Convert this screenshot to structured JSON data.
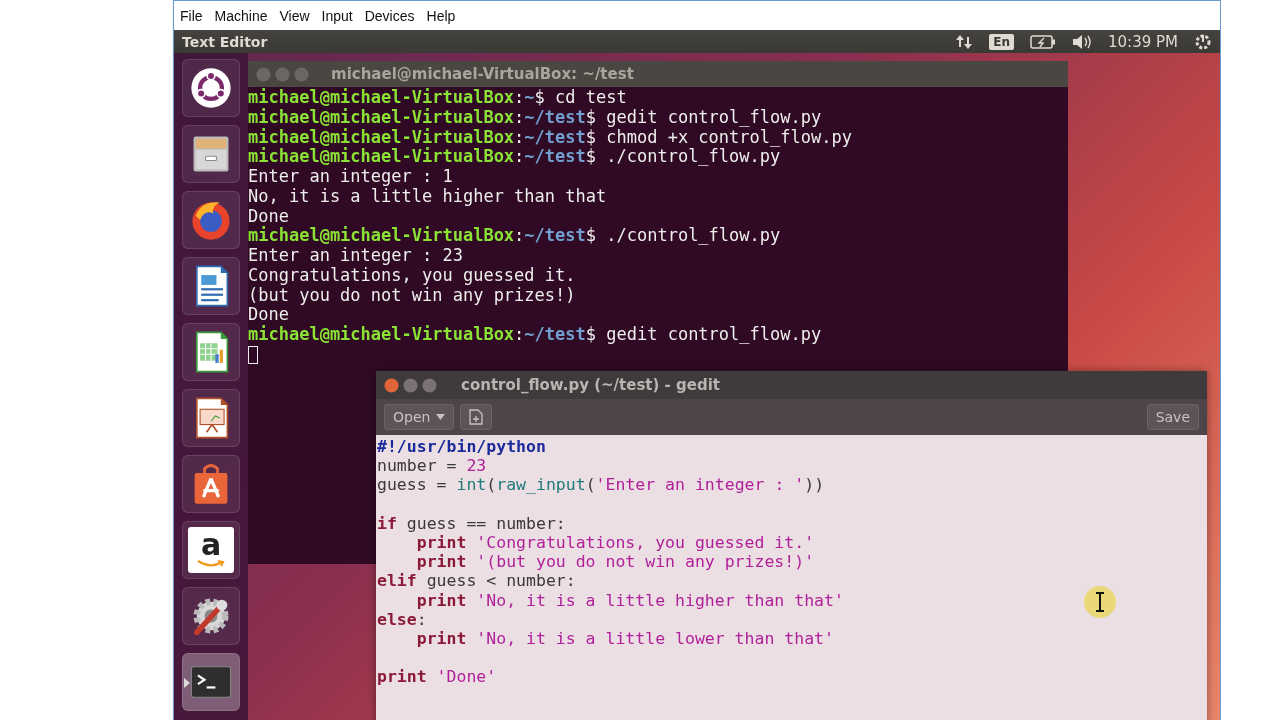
{
  "vbox_menu": [
    "File",
    "Machine",
    "View",
    "Input",
    "Devices",
    "Help"
  ],
  "top_panel": {
    "app_title": "Text Editor",
    "keyboard_layout": "En",
    "clock": "10:39 PM"
  },
  "launcher": [
    {
      "kind": "ubuntu",
      "running": false,
      "active": false
    },
    {
      "kind": "files",
      "running": false,
      "active": false
    },
    {
      "kind": "browser",
      "running": false,
      "active": false
    },
    {
      "kind": "writer",
      "running": false,
      "active": false
    },
    {
      "kind": "calc",
      "running": false,
      "active": false
    },
    {
      "kind": "impress",
      "running": false,
      "active": false
    },
    {
      "kind": "software",
      "running": false,
      "active": false
    },
    {
      "kind": "amazon",
      "glyph": "a",
      "running": false,
      "active": false
    },
    {
      "kind": "settings",
      "running": false,
      "active": false
    },
    {
      "kind": "terminal",
      "running": true,
      "active": true
    }
  ],
  "terminal": {
    "title": "michael@michael-VirtualBox: ~/test",
    "cursor": true,
    "lines": [
      [
        {
          "text": "michael@michael-VirtualBox",
          "kind": "user"
        },
        {
          "text": ":",
          "kind": "plain"
        },
        {
          "text": "~",
          "kind": "path"
        },
        {
          "text": "$ cd test",
          "kind": "plain"
        }
      ],
      [
        {
          "text": "michael@michael-VirtualBox",
          "kind": "user"
        },
        {
          "text": ":",
          "kind": "plain"
        },
        {
          "text": "~/test",
          "kind": "path"
        },
        {
          "text": "$ gedit control_flow.py",
          "kind": "plain"
        }
      ],
      [
        {
          "text": "michael@michael-VirtualBox",
          "kind": "user"
        },
        {
          "text": ":",
          "kind": "plain"
        },
        {
          "text": "~/test",
          "kind": "path"
        },
        {
          "text": "$ chmod +x control_flow.py",
          "kind": "plain"
        }
      ],
      [
        {
          "text": "michael@michael-VirtualBox",
          "kind": "user"
        },
        {
          "text": ":",
          "kind": "plain"
        },
        {
          "text": "~/test",
          "kind": "path"
        },
        {
          "text": "$ ./control_flow.py",
          "kind": "plain"
        }
      ],
      [
        {
          "text": "Enter an integer : 1",
          "kind": "plain"
        }
      ],
      [
        {
          "text": "No, it is a little higher than that",
          "kind": "plain"
        }
      ],
      [
        {
          "text": "Done",
          "kind": "plain"
        }
      ],
      [
        {
          "text": "michael@michael-VirtualBox",
          "kind": "user"
        },
        {
          "text": ":",
          "kind": "plain"
        },
        {
          "text": "~/test",
          "kind": "path"
        },
        {
          "text": "$ ./control_flow.py",
          "kind": "plain"
        }
      ],
      [
        {
          "text": "Enter an integer : 23",
          "kind": "plain"
        }
      ],
      [
        {
          "text": "Congratulations, you guessed it.",
          "kind": "plain"
        }
      ],
      [
        {
          "text": "(but you do not win any prizes!)",
          "kind": "plain"
        }
      ],
      [
        {
          "text": "Done",
          "kind": "plain"
        }
      ],
      [
        {
          "text": "michael@michael-VirtualBox",
          "kind": "user"
        },
        {
          "text": ":",
          "kind": "plain"
        },
        {
          "text": "~/test",
          "kind": "path"
        },
        {
          "text": "$ gedit control_flow.py",
          "kind": "plain"
        }
      ]
    ]
  },
  "gedit": {
    "title": "control_flow.py (~/test) - gedit",
    "open_button": "Open",
    "save_button": "Save",
    "lines": [
      {
        "blank_before": false,
        "indented": false,
        "segments": [
          {
            "text": "#!/usr/bin/python",
            "kind": "shebang"
          }
        ]
      },
      {
        "blank_before": false,
        "indented": false,
        "segments": [
          {
            "text": "number = ",
            "kind": "plain"
          },
          {
            "text": "23",
            "kind": "number"
          }
        ]
      },
      {
        "blank_before": false,
        "indented": false,
        "segments": [
          {
            "text": "guess = ",
            "kind": "plain"
          },
          {
            "text": "int",
            "kind": "builtin"
          },
          {
            "text": "(",
            "kind": "plain"
          },
          {
            "text": "raw_input",
            "kind": "builtin"
          },
          {
            "text": "(",
            "kind": "plain"
          },
          {
            "text": "'Enter an integer : '",
            "kind": "string"
          },
          {
            "text": "))",
            "kind": "plain"
          }
        ]
      },
      {
        "blank_before": true,
        "indented": false,
        "segments": [
          {
            "text": "if",
            "kind": "keyword"
          },
          {
            "text": " guess == number:",
            "kind": "plain"
          }
        ]
      },
      {
        "blank_before": false,
        "indented": true,
        "segments": [
          {
            "text": "print",
            "kind": "keyword"
          },
          {
            "text": " 'Congratulations, you guessed it.'",
            "kind": "string"
          }
        ]
      },
      {
        "blank_before": false,
        "indented": true,
        "segments": [
          {
            "text": "print",
            "kind": "keyword"
          },
          {
            "text": " '(but you do not win any prizes!)'",
            "kind": "string"
          }
        ]
      },
      {
        "blank_before": false,
        "indented": false,
        "segments": [
          {
            "text": "elif",
            "kind": "keyword"
          },
          {
            "text": " guess < number:",
            "kind": "plain"
          }
        ]
      },
      {
        "blank_before": false,
        "indented": true,
        "segments": [
          {
            "text": "print",
            "kind": "keyword"
          },
          {
            "text": " 'No, it is a little higher than that'",
            "kind": "string"
          }
        ]
      },
      {
        "blank_before": false,
        "indented": false,
        "segments": [
          {
            "text": "else",
            "kind": "keyword"
          },
          {
            "text": ":",
            "kind": "plain"
          }
        ]
      },
      {
        "blank_before": false,
        "indented": true,
        "segments": [
          {
            "text": "print",
            "kind": "keyword"
          },
          {
            "text": " 'No, it is a little lower than that'",
            "kind": "string"
          }
        ]
      },
      {
        "blank_before": true,
        "indented": false,
        "segments": [
          {
            "text": "print",
            "kind": "keyword"
          },
          {
            "text": " 'Done'",
            "kind": "string"
          }
        ]
      }
    ]
  }
}
